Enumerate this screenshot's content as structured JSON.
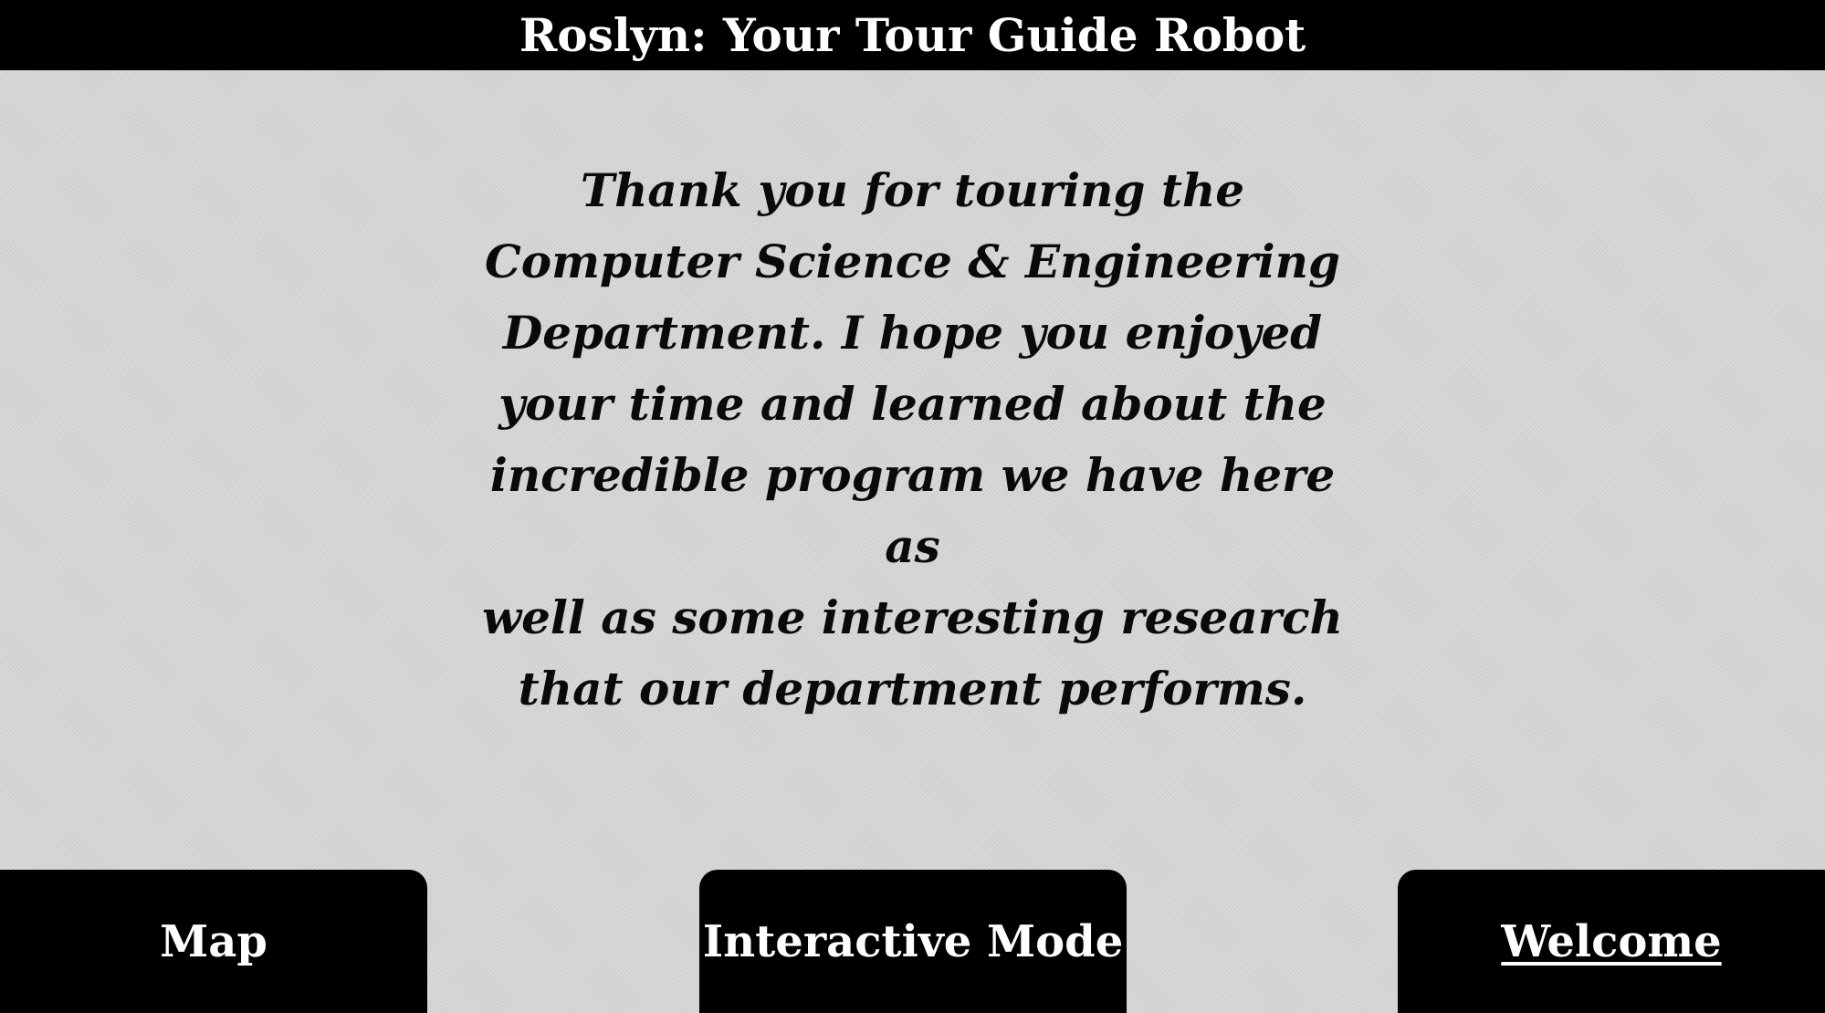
{
  "header": {
    "title": "Roslyn: Your Tour Guide Robot"
  },
  "main": {
    "message_lines": [
      "Thank you for touring the",
      "Computer Science & Engineering",
      "Department. I hope you enjoyed",
      "your time and learned about the",
      "incredible program we have here as",
      "well as some interesting research",
      "that our department performs."
    ]
  },
  "nav": {
    "map_label": "Map",
    "interactive_label": "Interactive Mode",
    "welcome_label": "Welcome"
  },
  "colors": {
    "header_background": "#000000",
    "page_background": "#d6d6d6",
    "button_background": "#000000",
    "button_text": "#ffffff"
  }
}
